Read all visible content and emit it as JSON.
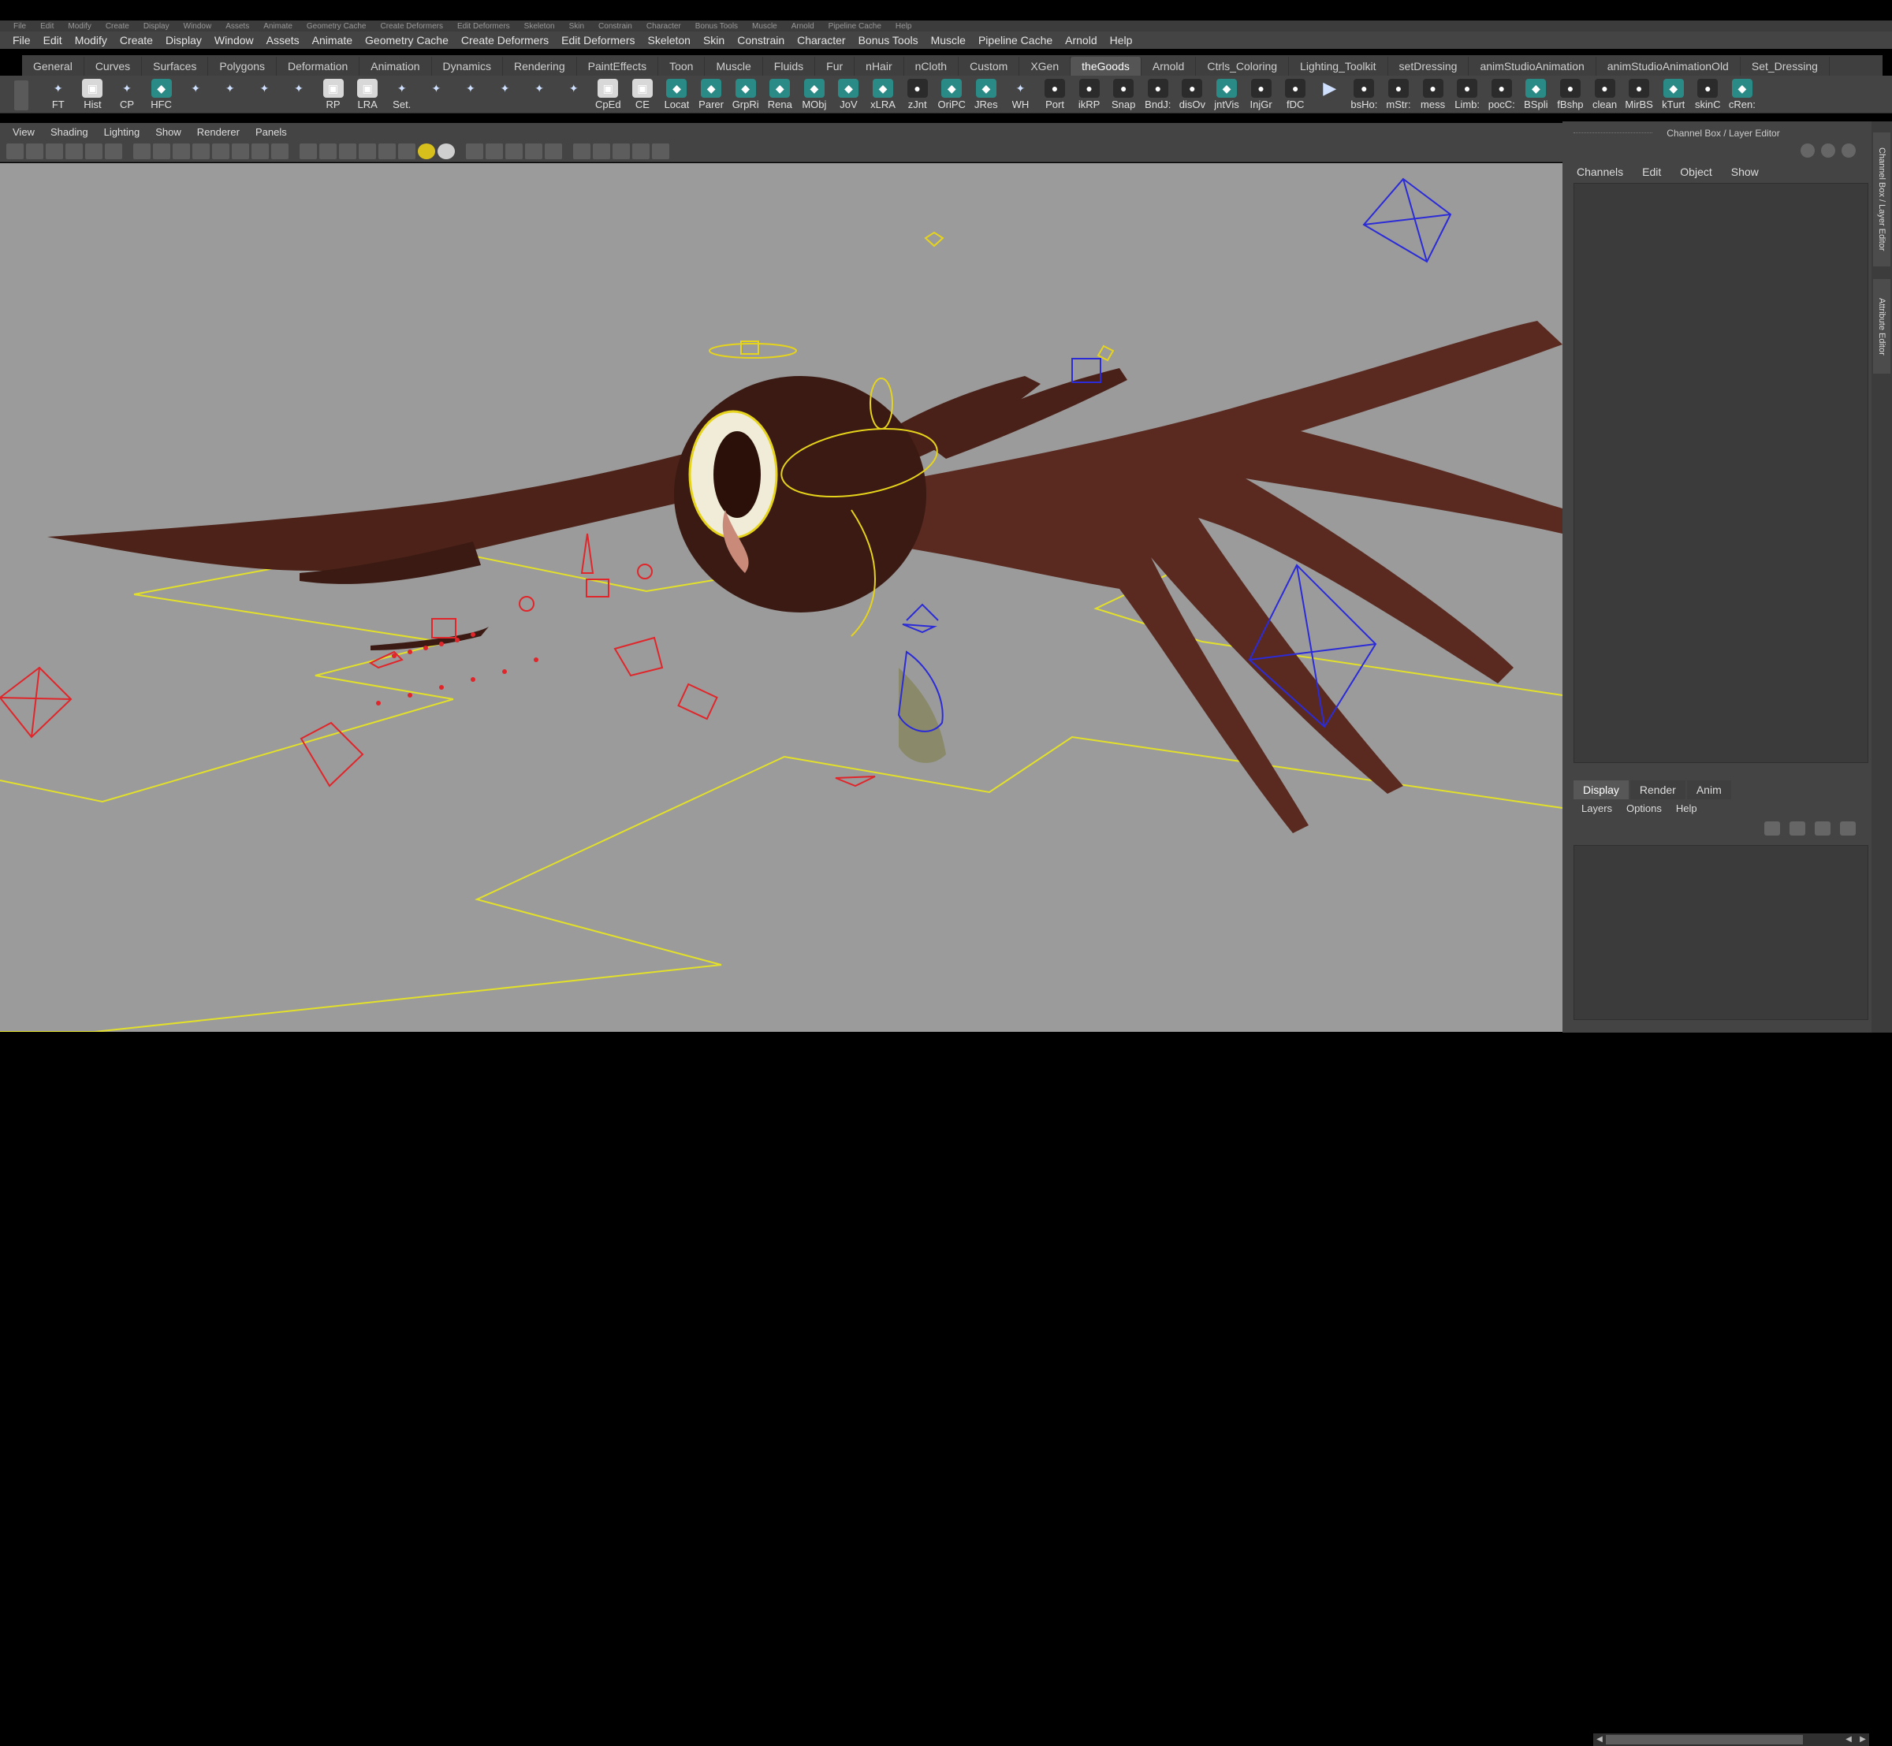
{
  "top_menu_faded": [
    "File",
    "Edit",
    "Modify",
    "Create",
    "Display",
    "Window",
    "Assets",
    "Animate",
    "Geometry Cache",
    "Create Deformers",
    "Edit Deformers",
    "Skeleton",
    "Skin",
    "Constrain",
    "Character",
    "Bonus Tools",
    "Muscle",
    "Arnold",
    "Pipeline Cache",
    "Help"
  ],
  "menubar": [
    "File",
    "Edit",
    "Modify",
    "Create",
    "Display",
    "Window",
    "Assets",
    "Animate",
    "Geometry Cache",
    "Create Deformers",
    "Edit Deformers",
    "Skeleton",
    "Skin",
    "Constrain",
    "Character",
    "Bonus Tools",
    "Muscle",
    "Pipeline Cache",
    "Arnold",
    "Help"
  ],
  "shelf_tabs": {
    "items": [
      "General",
      "Curves",
      "Surfaces",
      "Polygons",
      "Deformation",
      "Animation",
      "Dynamics",
      "Rendering",
      "PaintEffects",
      "Toon",
      "Muscle",
      "Fluids",
      "Fur",
      "nHair",
      "nCloth",
      "Custom",
      "XGen",
      "theGoods",
      "Arnold",
      "Ctrls_Coloring",
      "Lighting_Toolkit",
      "setDressing",
      "animStudioAnimation",
      "animStudioAnimationOld",
      "Set_Dressing"
    ],
    "active": "theGoods"
  },
  "shelf_buttons": [
    {
      "label": "FT",
      "style": "none"
    },
    {
      "label": "Hist",
      "style": "white"
    },
    {
      "label": "CP",
      "style": "none"
    },
    {
      "label": "HFC",
      "style": "teal"
    },
    {
      "label": "",
      "style": "none"
    },
    {
      "label": "",
      "style": "none"
    },
    {
      "label": "",
      "style": "none"
    },
    {
      "label": "",
      "style": "none"
    },
    {
      "label": "RP",
      "style": "white"
    },
    {
      "label": "LRA",
      "style": "white"
    },
    {
      "label": "Set.",
      "style": "none"
    },
    {
      "label": "",
      "style": "none"
    },
    {
      "label": "",
      "style": "none"
    },
    {
      "label": "",
      "style": "none"
    },
    {
      "label": "",
      "style": "none"
    },
    {
      "label": "",
      "style": "none"
    },
    {
      "label": "CpEd",
      "style": "white"
    },
    {
      "label": "CE",
      "style": "white"
    },
    {
      "label": "Locat",
      "style": "teal"
    },
    {
      "label": "Parer",
      "style": "teal"
    },
    {
      "label": "GrpRi",
      "style": "teal"
    },
    {
      "label": "Rena",
      "style": "teal"
    },
    {
      "label": "MObj",
      "style": "teal"
    },
    {
      "label": "JoV",
      "style": "teal"
    },
    {
      "label": "xLRA",
      "style": "teal"
    },
    {
      "label": "zJnt",
      "style": "dark"
    },
    {
      "label": "OriPC",
      "style": "teal"
    },
    {
      "label": "JRes",
      "style": "teal"
    },
    {
      "label": "WH",
      "style": "none"
    },
    {
      "label": "Port",
      "style": "dark"
    },
    {
      "label": "ikRP",
      "style": "dark"
    },
    {
      "label": "Snap",
      "style": "dark"
    },
    {
      "label": "BndJ:",
      "style": "dark"
    },
    {
      "label": "disOv",
      "style": "dark"
    },
    {
      "label": "jntVis",
      "style": "teal"
    },
    {
      "label": "InjGr",
      "style": "dark"
    },
    {
      "label": "fDC",
      "style": "dark"
    },
    {
      "label": "",
      "style": "none"
    },
    {
      "label": "bsHo:",
      "style": "dark"
    },
    {
      "label": "mStr:",
      "style": "dark"
    },
    {
      "label": "mess",
      "style": "dark"
    },
    {
      "label": "Limb:",
      "style": "dark"
    },
    {
      "label": "pocC:",
      "style": "dark"
    },
    {
      "label": "BSpli",
      "style": "teal"
    },
    {
      "label": "fBshp",
      "style": "dark"
    },
    {
      "label": "clean",
      "style": "dark"
    },
    {
      "label": "MirBS",
      "style": "dark"
    },
    {
      "label": "kTurt",
      "style": "teal"
    },
    {
      "label": "skinC",
      "style": "dark"
    },
    {
      "label": "cRen:",
      "style": "teal"
    }
  ],
  "viewport_menu": [
    "View",
    "Shading",
    "Lighting",
    "Show",
    "Renderer",
    "Panels"
  ],
  "right_panel": {
    "title": "Channel Box / Layer Editor",
    "channel_menu": [
      "Channels",
      "Edit",
      "Object",
      "Show"
    ],
    "side_tabs": [
      "Channel Box / Layer Editor",
      "Attribute Editor"
    ],
    "layer_tabs": [
      "Display",
      "Render",
      "Anim"
    ],
    "layer_active": "Display",
    "layer_menu": [
      "Layers",
      "Options",
      "Help"
    ]
  },
  "colors": {
    "viewport_bg": "#9b9b9b",
    "ground_line": "#e3e02a",
    "rig_red": "#e0262a",
    "rig_blue": "#2b2bd8",
    "rig_yellow": "#e6d41c",
    "feather": "#5a2a20"
  }
}
